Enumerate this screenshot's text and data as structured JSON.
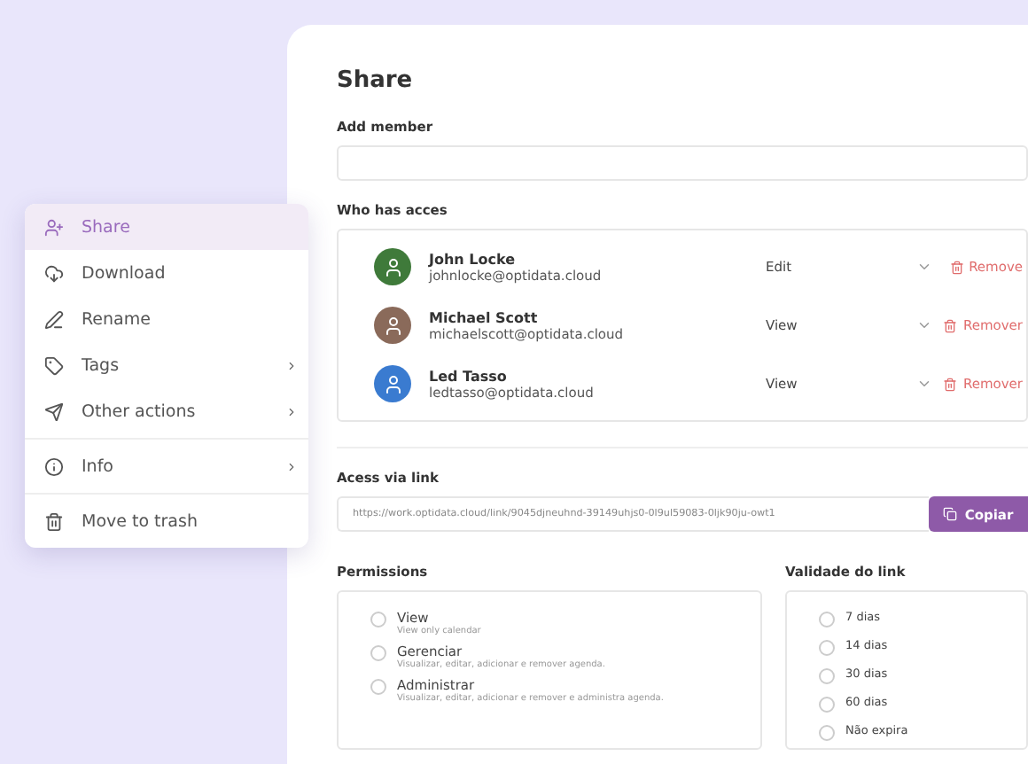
{
  "share": {
    "title": "Share",
    "add_member": {
      "label": "Add member"
    },
    "access": {
      "label": "Who has acces",
      "members": [
        {
          "name": "John Locke",
          "email": "johnlocke@optidata.cloud",
          "role": "Edit",
          "remove": "Remove",
          "color": "#3f7a3a"
        },
        {
          "name": "Michael Scott",
          "email": "michaelscott@optidata.cloud",
          "role": "View",
          "remove": "Remover",
          "color": "#8a6a5a"
        },
        {
          "name": "Led Tasso",
          "email": "ledtasso@optidata.cloud",
          "role": "View",
          "remove": "Remover",
          "color": "#3a7bd0"
        }
      ]
    },
    "link": {
      "label": "Acess via link",
      "value": "https://work.optidata.cloud/link/9045djneuhnd-39149uhjs0-0l9ul59083-0ljk90ju-owt1",
      "button": "Copiar"
    },
    "permissions": {
      "label": "Permissions",
      "options": [
        {
          "label": "View",
          "hint": "View only calendar",
          "selected": false
        },
        {
          "label": "Gerenciar",
          "hint": "Visualizar, editar, adicionar e remover agenda.",
          "selected": false
        },
        {
          "label": "Administrar",
          "hint": "Visualizar, editar, adicionar e remover e administra agenda.",
          "selected": false
        }
      ]
    },
    "validity": {
      "label": "Validade do link",
      "options": [
        {
          "label": "7 dias",
          "selected": false
        },
        {
          "label": "14 dias",
          "selected": false
        },
        {
          "label": "30 dias",
          "selected": false
        },
        {
          "label": "60 dias",
          "selected": false
        },
        {
          "label": "Não expira",
          "selected": false
        }
      ]
    }
  },
  "menu": {
    "groups": [
      [
        {
          "label": "Share",
          "selected": true,
          "submenu": false
        },
        {
          "label": "Download",
          "selected": false,
          "submenu": false
        },
        {
          "label": "Rename",
          "selected": false,
          "submenu": false
        },
        {
          "label": "Tags",
          "selected": false,
          "submenu": true
        },
        {
          "label": "Other actions",
          "selected": false,
          "submenu": true
        }
      ],
      [
        {
          "label": "Info",
          "selected": false,
          "submenu": true
        }
      ],
      [
        {
          "label": "Move to trash",
          "selected": false,
          "submenu": false
        }
      ]
    ]
  }
}
